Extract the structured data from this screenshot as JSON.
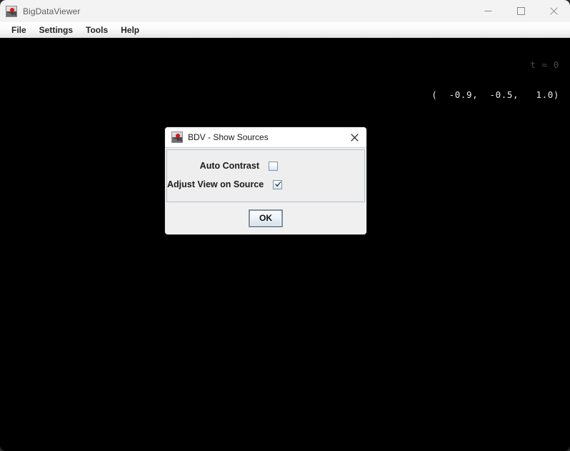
{
  "window": {
    "title": "BigDataViewer",
    "icon": "bigdataviewer-app-icon",
    "controls": {
      "minimize": "minimize-button",
      "maximize": "maximize-button",
      "close": "close-button"
    }
  },
  "menubar": {
    "items": [
      {
        "label": "File"
      },
      {
        "label": "Settings"
      },
      {
        "label": "Tools"
      },
      {
        "label": "Help"
      }
    ]
  },
  "viewer": {
    "background_color": "#000000",
    "overlay": {
      "time_label": "t = 0",
      "time_color": "#4a4a4a",
      "coords_label": "(  -0.9,  -0.5,   1.0)",
      "coords_color": "#e8e8e8"
    }
  },
  "dialog": {
    "title": "BDV - Show Sources",
    "icon": "bigdataviewer-app-icon",
    "close_label": "close-icon",
    "controls": [
      {
        "label": "Auto Contrast",
        "type": "checkbox",
        "checked": false
      },
      {
        "label": "Adjust View on Source",
        "type": "checkbox",
        "checked": true
      }
    ],
    "buttons": [
      {
        "label": "OK"
      }
    ]
  }
}
